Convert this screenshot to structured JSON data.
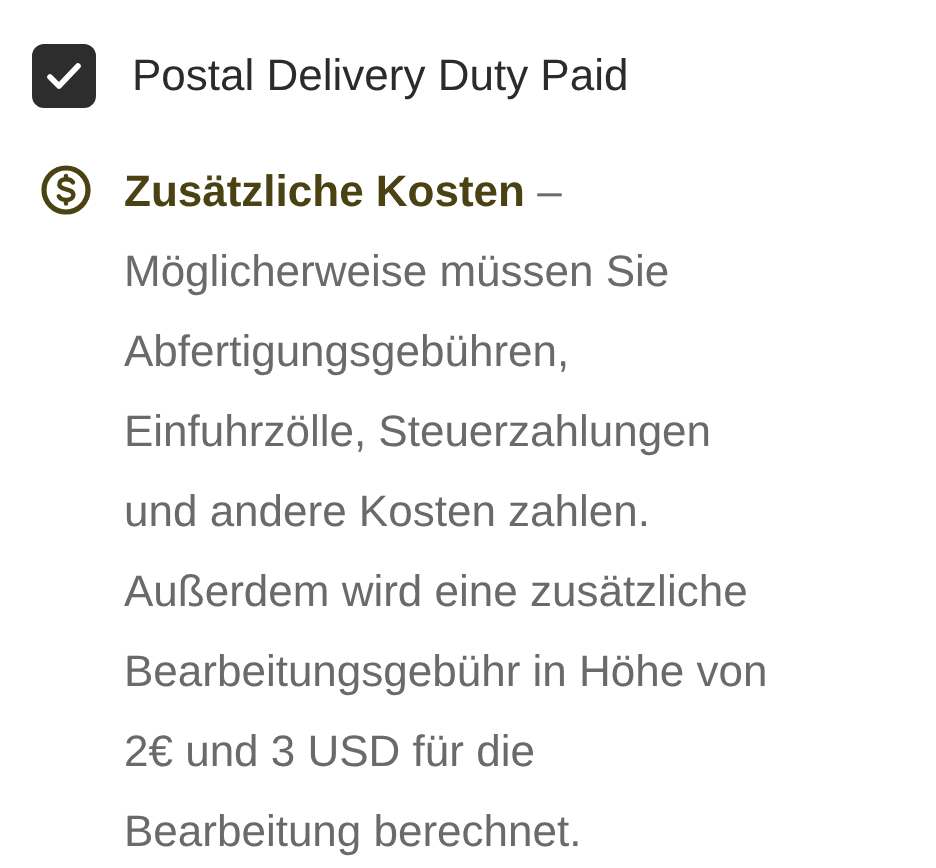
{
  "checkbox": {
    "label": "Postal Delivery Duty Paid",
    "checked": true
  },
  "notice": {
    "text": "**Zusätzliche Kosten** – Möglicherweise müssen Sie Abfertigungsgebühren, Einfuhrzölle, Steuerzahlungen und andere Kosten zahlen. Außerdem wird eine zusätzliche Bearbeitungsgebühr in Höhe von 2€ und 3 USD für die Bearbeitung berechnet."
  }
}
